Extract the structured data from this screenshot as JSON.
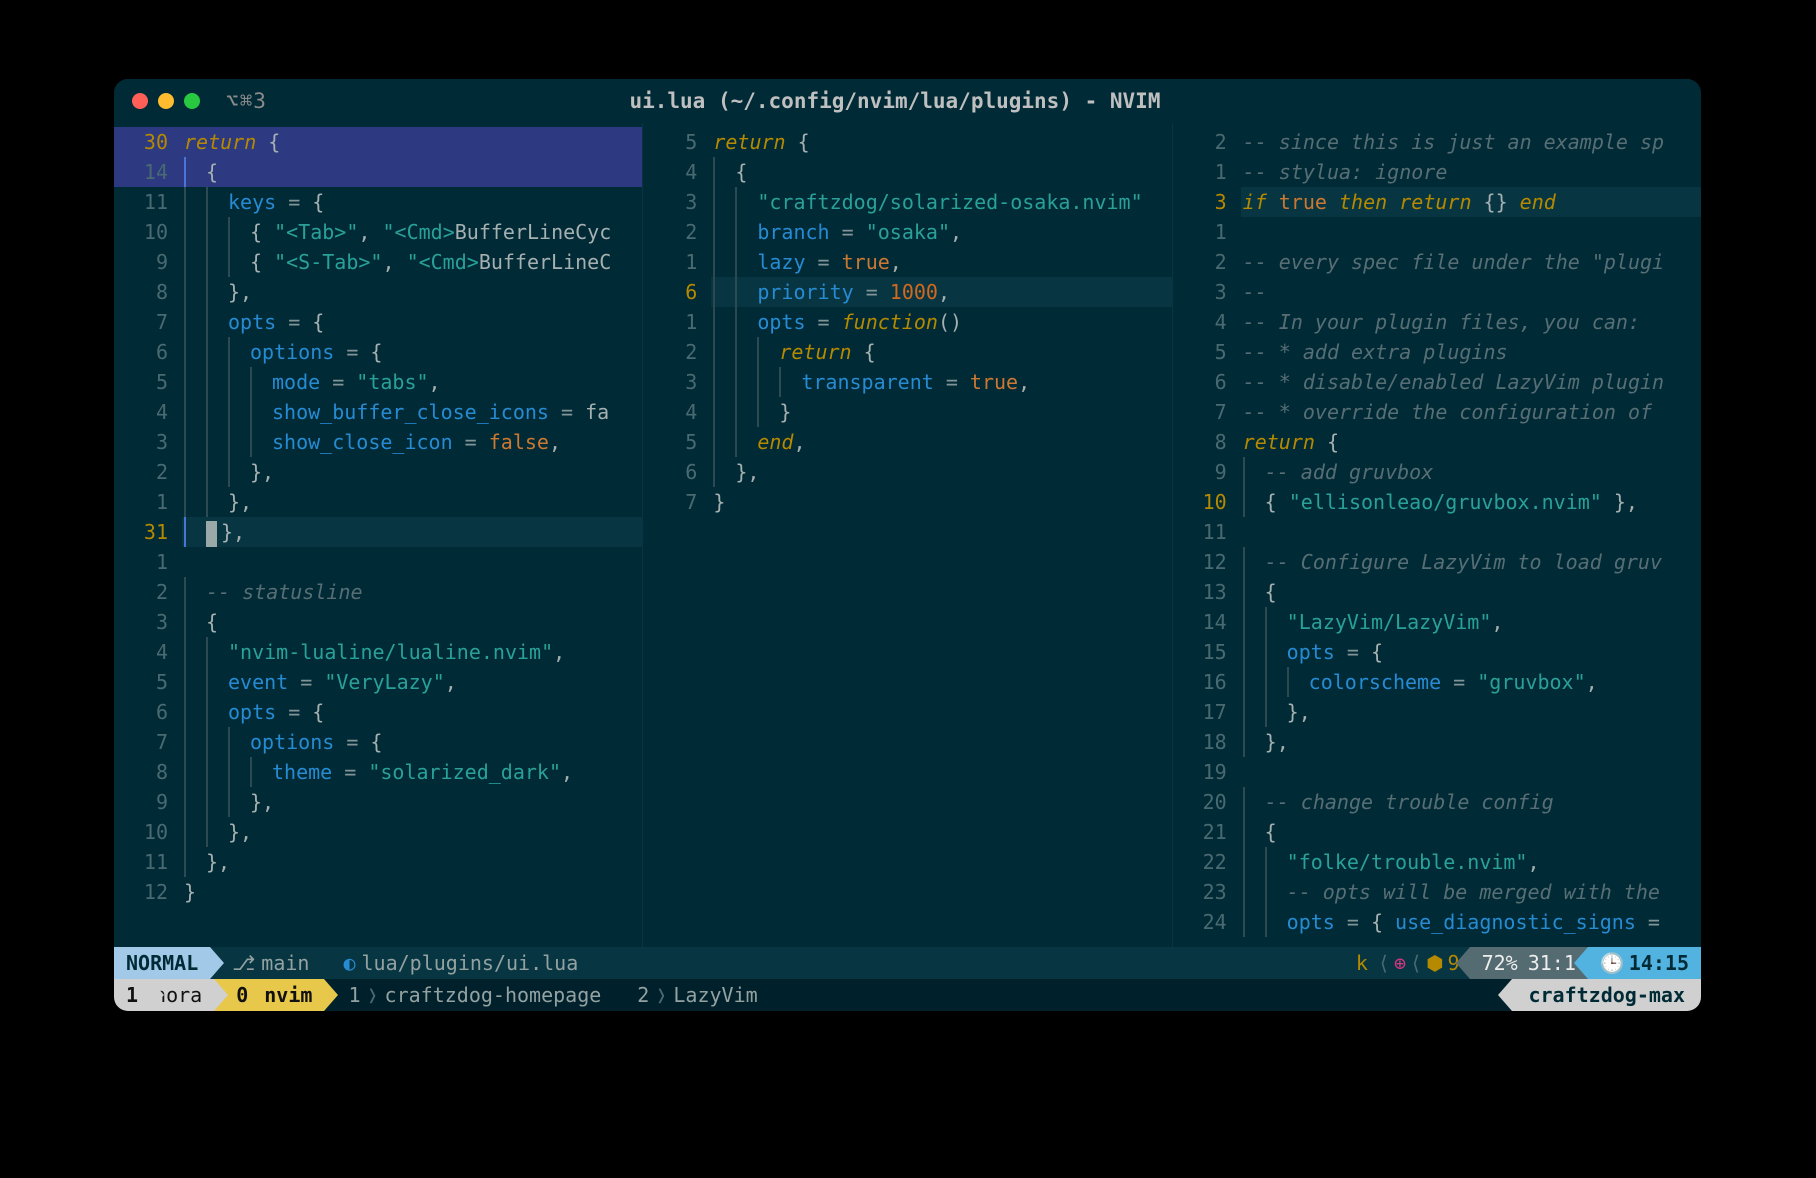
{
  "window": {
    "tabinfo": "⌥⌘3",
    "title": "ui.lua (~/.config/nvim/lua/plugins) - NVIM"
  },
  "pane1": {
    "rows": [
      {
        "n": "30",
        "cur": true,
        "sel": true,
        "ind": 0,
        "tokens": [
          [
            "kw",
            "return"
          ],
          [
            "punc",
            " {"
          ]
        ]
      },
      {
        "n": "14",
        "sel": true,
        "ind": 1,
        "tokens": [
          [
            "punc",
            "{"
          ]
        ]
      },
      {
        "n": "11",
        "ind": 2,
        "tokens": [
          [
            "key",
            "keys"
          ],
          [
            "op",
            " = "
          ],
          [
            "punc",
            "{"
          ]
        ]
      },
      {
        "n": "10",
        "ind": 3,
        "tokens": [
          [
            "punc",
            "{ "
          ],
          [
            "str",
            "\"<Tab>\""
          ],
          [
            "punc",
            ", "
          ],
          [
            "str",
            "\"<Cmd>"
          ],
          [
            "var",
            "BufferLineCyc"
          ]
        ]
      },
      {
        "n": "9",
        "ind": 3,
        "tokens": [
          [
            "punc",
            "{ "
          ],
          [
            "str",
            "\"<S-Tab>\""
          ],
          [
            "punc",
            ", "
          ],
          [
            "str",
            "\"<Cmd>"
          ],
          [
            "var",
            "BufferLineC"
          ]
        ]
      },
      {
        "n": "8",
        "ind": 2,
        "tokens": [
          [
            "punc",
            "},"
          ]
        ]
      },
      {
        "n": "7",
        "ind": 2,
        "tokens": [
          [
            "key",
            "opts"
          ],
          [
            "op",
            " = "
          ],
          [
            "punc",
            "{"
          ]
        ]
      },
      {
        "n": "6",
        "ind": 3,
        "tokens": [
          [
            "key",
            "options"
          ],
          [
            "op",
            " = "
          ],
          [
            "punc",
            "{"
          ]
        ]
      },
      {
        "n": "5",
        "ind": 4,
        "tokens": [
          [
            "key",
            "mode"
          ],
          [
            "op",
            " = "
          ],
          [
            "str",
            "\"tabs\""
          ],
          [
            "punc",
            ","
          ]
        ]
      },
      {
        "n": "4",
        "ind": 4,
        "tokens": [
          [
            "key",
            "show_buffer_close_icons"
          ],
          [
            "op",
            " = "
          ],
          [
            "var",
            "fa"
          ]
        ]
      },
      {
        "n": "3",
        "ind": 4,
        "tokens": [
          [
            "key",
            "show_close_icon"
          ],
          [
            "op",
            " = "
          ],
          [
            "bool",
            "false"
          ],
          [
            "punc",
            ","
          ]
        ]
      },
      {
        "n": "2",
        "ind": 3,
        "tokens": [
          [
            "punc",
            "},"
          ]
        ]
      },
      {
        "n": "1",
        "ind": 2,
        "tokens": [
          [
            "punc",
            "},"
          ]
        ]
      },
      {
        "n": "31",
        "cur": true,
        "hl": true,
        "cursor": true,
        "ind": 1,
        "tokens": [
          [
            "punc",
            "},"
          ]
        ]
      },
      {
        "n": "1",
        "ind": 0,
        "tokens": [
          [
            "txt",
            ""
          ]
        ]
      },
      {
        "n": "2",
        "ind": 1,
        "tokens": [
          [
            "cm",
            "-- statusline"
          ]
        ]
      },
      {
        "n": "3",
        "ind": 1,
        "tokens": [
          [
            "punc",
            "{"
          ]
        ]
      },
      {
        "n": "4",
        "ind": 2,
        "tokens": [
          [
            "str",
            "\"nvim-lualine/lualine.nvim\""
          ],
          [
            "punc",
            ","
          ]
        ]
      },
      {
        "n": "5",
        "ind": 2,
        "tokens": [
          [
            "key",
            "event"
          ],
          [
            "op",
            " = "
          ],
          [
            "str",
            "\"VeryLazy\""
          ],
          [
            "punc",
            ","
          ]
        ]
      },
      {
        "n": "6",
        "ind": 2,
        "tokens": [
          [
            "key",
            "opts"
          ],
          [
            "op",
            " = "
          ],
          [
            "punc",
            "{"
          ]
        ]
      },
      {
        "n": "7",
        "ind": 3,
        "tokens": [
          [
            "key",
            "options"
          ],
          [
            "op",
            " = "
          ],
          [
            "punc",
            "{"
          ]
        ]
      },
      {
        "n": "8",
        "ind": 4,
        "tokens": [
          [
            "key",
            "theme"
          ],
          [
            "op",
            " = "
          ],
          [
            "str",
            "\"solarized_dark\""
          ],
          [
            "punc",
            ","
          ]
        ]
      },
      {
        "n": "9",
        "ind": 3,
        "tokens": [
          [
            "punc",
            "},"
          ]
        ]
      },
      {
        "n": "10",
        "ind": 2,
        "tokens": [
          [
            "punc",
            "},"
          ]
        ]
      },
      {
        "n": "11",
        "ind": 1,
        "tokens": [
          [
            "punc",
            "},"
          ]
        ]
      },
      {
        "n": "12",
        "ind": 0,
        "tokens": [
          [
            "punc",
            "}"
          ]
        ]
      }
    ]
  },
  "pane2": {
    "rows": [
      {
        "n": "5",
        "ind": 0,
        "tokens": [
          [
            "kw",
            "return"
          ],
          [
            "punc",
            " {"
          ]
        ]
      },
      {
        "n": "4",
        "ind": 1,
        "tokens": [
          [
            "punc",
            "{"
          ]
        ]
      },
      {
        "n": "3",
        "ind": 2,
        "tokens": [
          [
            "str",
            "\"craftzdog/solarized-osaka.nvim\""
          ]
        ]
      },
      {
        "n": "2",
        "ind": 2,
        "tokens": [
          [
            "key",
            "branch"
          ],
          [
            "op",
            " = "
          ],
          [
            "str",
            "\"osaka\""
          ],
          [
            "punc",
            ","
          ]
        ]
      },
      {
        "n": "1",
        "ind": 2,
        "tokens": [
          [
            "key",
            "lazy"
          ],
          [
            "op",
            " = "
          ],
          [
            "bool",
            "true"
          ],
          [
            "punc",
            ","
          ]
        ]
      },
      {
        "n": "6",
        "cur": true,
        "hl": true,
        "ind": 2,
        "tokens": [
          [
            "key",
            "priority"
          ],
          [
            "op",
            " = "
          ],
          [
            "num",
            "1000"
          ],
          [
            "punc",
            ","
          ]
        ]
      },
      {
        "n": "1",
        "ind": 2,
        "tokens": [
          [
            "key",
            "opts"
          ],
          [
            "op",
            " = "
          ],
          [
            "kw",
            "function"
          ],
          [
            "punc",
            "()"
          ]
        ]
      },
      {
        "n": "2",
        "ind": 3,
        "tokens": [
          [
            "kw",
            "return"
          ],
          [
            "punc",
            " {"
          ]
        ]
      },
      {
        "n": "3",
        "ind": 4,
        "tokens": [
          [
            "key",
            "transparent"
          ],
          [
            "op",
            " = "
          ],
          [
            "bool",
            "true"
          ],
          [
            "punc",
            ","
          ]
        ]
      },
      {
        "n": "4",
        "ind": 3,
        "tokens": [
          [
            "punc",
            "}"
          ]
        ]
      },
      {
        "n": "5",
        "ind": 2,
        "tokens": [
          [
            "kw",
            "end"
          ],
          [
            "punc",
            ","
          ]
        ]
      },
      {
        "n": "6",
        "ind": 1,
        "tokens": [
          [
            "punc",
            "},"
          ]
        ]
      },
      {
        "n": "7",
        "ind": 0,
        "tokens": [
          [
            "punc",
            "}"
          ]
        ]
      }
    ]
  },
  "pane3": {
    "rows": [
      {
        "n": "2",
        "ind": 0,
        "tokens": [
          [
            "cm",
            "-- since this is just an example sp"
          ]
        ]
      },
      {
        "n": "1",
        "ind": 0,
        "tokens": [
          [
            "cm",
            "-- stylua: ignore"
          ]
        ]
      },
      {
        "n": "3",
        "cur": true,
        "hl": true,
        "ind": 0,
        "tokens": [
          [
            "kw",
            "if"
          ],
          [
            "txt",
            " "
          ],
          [
            "bool",
            "true"
          ],
          [
            "txt",
            " "
          ],
          [
            "kw",
            "then"
          ],
          [
            "txt",
            " "
          ],
          [
            "kw",
            "return"
          ],
          [
            "punc",
            " {} "
          ],
          [
            "kw",
            "end"
          ]
        ]
      },
      {
        "n": "1",
        "ind": 0,
        "tokens": [
          [
            "txt",
            ""
          ]
        ]
      },
      {
        "n": "2",
        "ind": 0,
        "tokens": [
          [
            "cm",
            "-- every spec file under the \"plugi"
          ]
        ]
      },
      {
        "n": "3",
        "ind": 0,
        "tokens": [
          [
            "cm",
            "--"
          ]
        ]
      },
      {
        "n": "4",
        "ind": 0,
        "tokens": [
          [
            "cm",
            "-- In your plugin files, you can:"
          ]
        ]
      },
      {
        "n": "5",
        "ind": 0,
        "tokens": [
          [
            "cm",
            "-- * add extra plugins"
          ]
        ]
      },
      {
        "n": "6",
        "ind": 0,
        "tokens": [
          [
            "cm",
            "-- * disable/enabled LazyVim plugin"
          ]
        ]
      },
      {
        "n": "7",
        "ind": 0,
        "tokens": [
          [
            "cm",
            "-- * override the configuration of"
          ]
        ]
      },
      {
        "n": "8",
        "ind": 0,
        "tokens": [
          [
            "kw",
            "return"
          ],
          [
            "punc",
            " {"
          ]
        ]
      },
      {
        "n": "9",
        "ind": 1,
        "tokens": [
          [
            "cm",
            "-- add gruvbox"
          ]
        ]
      },
      {
        "n": "10",
        "cur": true,
        "ind": 1,
        "tokens": [
          [
            "punc",
            "{ "
          ],
          [
            "str",
            "\"ellisonleao/gruvbox.nvim\""
          ],
          [
            "punc",
            " },"
          ]
        ]
      },
      {
        "n": "11",
        "ind": 0,
        "tokens": [
          [
            "txt",
            ""
          ]
        ]
      },
      {
        "n": "12",
        "ind": 1,
        "tokens": [
          [
            "cm",
            "-- Configure LazyVim to load gruv"
          ]
        ]
      },
      {
        "n": "13",
        "ind": 1,
        "tokens": [
          [
            "punc",
            "{"
          ]
        ]
      },
      {
        "n": "14",
        "ind": 2,
        "tokens": [
          [
            "str",
            "\"LazyVim/LazyVim\""
          ],
          [
            "punc",
            ","
          ]
        ]
      },
      {
        "n": "15",
        "ind": 2,
        "tokens": [
          [
            "key",
            "opts"
          ],
          [
            "op",
            " = "
          ],
          [
            "punc",
            "{"
          ]
        ]
      },
      {
        "n": "16",
        "ind": 3,
        "tokens": [
          [
            "key",
            "colorscheme"
          ],
          [
            "op",
            " = "
          ],
          [
            "str",
            "\"gruvbox\""
          ],
          [
            "punc",
            ","
          ]
        ]
      },
      {
        "n": "17",
        "ind": 2,
        "tokens": [
          [
            "punc",
            "},"
          ]
        ]
      },
      {
        "n": "18",
        "ind": 1,
        "tokens": [
          [
            "punc",
            "},"
          ]
        ]
      },
      {
        "n": "19",
        "ind": 0,
        "tokens": [
          [
            "txt",
            ""
          ]
        ]
      },
      {
        "n": "20",
        "ind": 1,
        "tokens": [
          [
            "cm",
            "-- change trouble config"
          ]
        ]
      },
      {
        "n": "21",
        "ind": 1,
        "tokens": [
          [
            "punc",
            "{"
          ]
        ]
      },
      {
        "n": "22",
        "ind": 2,
        "tokens": [
          [
            "str",
            "\"folke/trouble.nvim\""
          ],
          [
            "punc",
            ","
          ]
        ]
      },
      {
        "n": "23",
        "ind": 2,
        "tokens": [
          [
            "cm",
            "-- opts will be merged with the"
          ]
        ]
      },
      {
        "n": "24",
        "ind": 2,
        "tokens": [
          [
            "key",
            "opts"
          ],
          [
            "op",
            " = "
          ],
          [
            "punc",
            "{ "
          ],
          [
            "key",
            "use_diagnostic_signs"
          ],
          [
            "op",
            " ="
          ]
        ]
      }
    ]
  },
  "statusline": {
    "mode": "NORMAL",
    "branch_icon": "",
    "branch": "main",
    "file_icon": "",
    "file": "lua/plugins/ui.lua",
    "macro": "k",
    "copilot_icon": "",
    "cube_icon": "⬡",
    "diag_count": "9",
    "percent": "72%",
    "position": "31:1",
    "clock_icon": "◷",
    "time": "14:15"
  },
  "tmux": {
    "s1_idx": "1",
    "s1_name": "nora",
    "s0_idx": "0",
    "s0_name": "nvim",
    "w1_idx": "1",
    "w1_name": "craftzdog-homepage",
    "w2_idx": "2",
    "w2_name": "LazyVim",
    "host": "craftzdog-max"
  }
}
